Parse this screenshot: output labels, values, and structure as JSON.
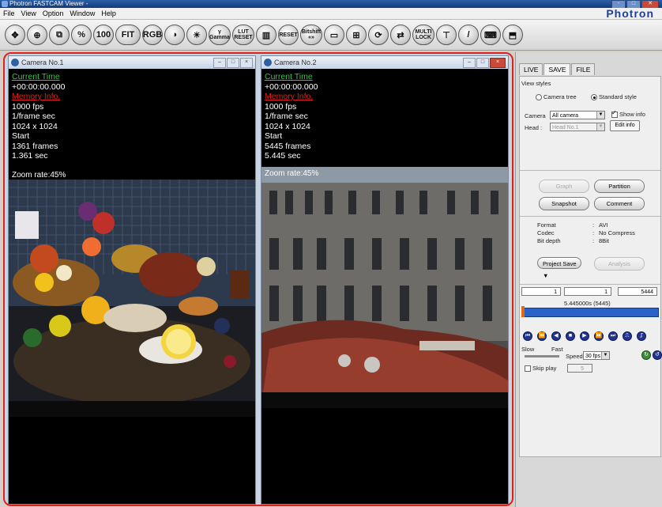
{
  "window": {
    "title": "Photron FASTCAM Viewer -",
    "buttons": [
      "-",
      "□",
      "✕"
    ]
  },
  "menu": [
    "File",
    "View",
    "Option",
    "Window",
    "Help"
  ],
  "brand": "Photron",
  "toolbar": [
    {
      "name": "move-icon",
      "label": "✥"
    },
    {
      "name": "zoom-in-icon",
      "label": "⊕"
    },
    {
      "name": "crop-icon",
      "label": "⧉"
    },
    {
      "name": "percent-zoom-button",
      "label": "%"
    },
    {
      "name": "zoom-100-button",
      "label": "100"
    },
    {
      "name": "fit-button",
      "label": "FIT"
    },
    {
      "name": "rgb-button",
      "label": "RGB"
    },
    {
      "name": "contrast-icon",
      "label": "◑"
    },
    {
      "name": "brightness-icon",
      "label": "☀"
    },
    {
      "name": "gamma-button",
      "label": "γ Gamma"
    },
    {
      "name": "lut-reset-button",
      "label": "LUT RESET"
    },
    {
      "name": "color-bars-icon",
      "label": "▥"
    },
    {
      "name": "histogram-reset-button",
      "label": "RESET"
    },
    {
      "name": "bitshift-button",
      "label": "Bitshift «»"
    },
    {
      "name": "rectangle-icon",
      "label": "▭"
    },
    {
      "name": "multi-window-icon",
      "label": "⊞"
    },
    {
      "name": "refresh-icon",
      "label": "⟳"
    },
    {
      "name": "sync-icon",
      "label": "⇄"
    },
    {
      "name": "multi-lock-button",
      "label": "MULTI LOCK"
    },
    {
      "name": "trigger-icon",
      "label": "⊤"
    },
    {
      "name": "pen-icon",
      "label": "/"
    },
    {
      "name": "keyboard-icon",
      "label": "⌨"
    },
    {
      "name": "export-icon",
      "label": "⬒"
    }
  ],
  "cameras": [
    {
      "title": "Camera No.1",
      "current_time_label": "Current Time",
      "current_time": "+00:00:00.000",
      "memory_label": "Memory Info.",
      "fps": "1000 fps",
      "shutter": "1/frame sec",
      "resolution": "1024 x 1024",
      "start": "Start",
      "frames": "1361 frames",
      "duration": "1.361 sec",
      "zoom": "Zoom rate:45%"
    },
    {
      "title": "Camera No.2",
      "current_time_label": "Current Time",
      "current_time": "+00:00:00.000",
      "memory_label": "Memory Info.",
      "fps": "1000 fps",
      "shutter": "1/frame sec",
      "resolution": "1024 x 1024",
      "start": "Start",
      "frames": "5445 frames",
      "duration": "5.445 sec",
      "zoom": "Zoom rate:45%"
    }
  ],
  "sidebar": {
    "tabs": [
      "LIVE",
      "SAVE",
      "FILE"
    ],
    "view_styles_label": "View styles",
    "camera_tree": "Camera tree",
    "standard_style": "Standard style",
    "camera_label": "Camera",
    "camera_value": "All camera",
    "show_info": "Show info",
    "head_label": "Head :",
    "head_value": "Head No.1",
    "edit_info": "Edit info",
    "graph": "Graph",
    "partition": "Partition",
    "snapshot": "Snapshot",
    "comment": "Comment",
    "format_label": "Format",
    "format_value": "AVI",
    "codec_label": "Codec",
    "codec_value": "No Compress",
    "bitdepth_label": "Bit depth",
    "bitdepth_value": "8Bit",
    "project_save": "Project Save",
    "analysis": "Analysis",
    "frame_start": "1",
    "frame_current": "1",
    "frame_end": "5444",
    "timecode": "5.445000s (5445)",
    "slow": "Slow",
    "fast": "Fast",
    "speed_label": "Speed",
    "speed_value": "30 fps",
    "skip_play": "Skip play",
    "skip_value": "5"
  }
}
